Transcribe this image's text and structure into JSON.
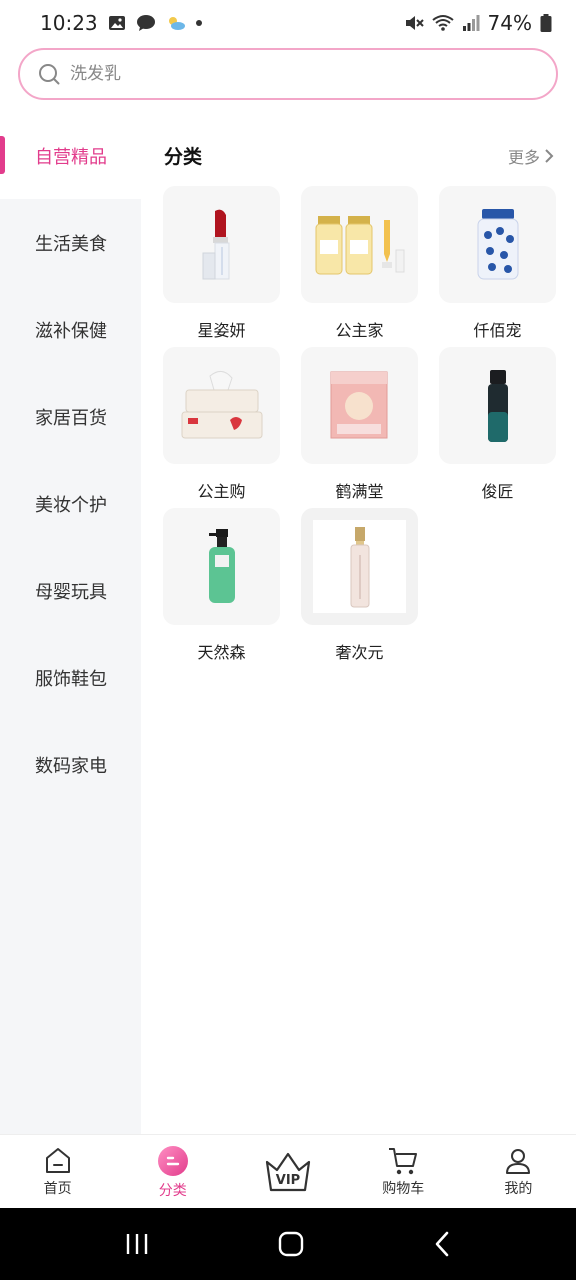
{
  "status_bar": {
    "time": "10:23",
    "battery": "74%"
  },
  "search": {
    "placeholder": "洗发乳"
  },
  "sidebar": {
    "items": [
      {
        "label": "自营精品",
        "active": true
      },
      {
        "label": "生活美食"
      },
      {
        "label": "滋补保健"
      },
      {
        "label": "家居百货"
      },
      {
        "label": "美妆个护"
      },
      {
        "label": "母婴玩具"
      },
      {
        "label": "服饰鞋包"
      },
      {
        "label": "数码家电"
      }
    ]
  },
  "main": {
    "section_title": "分类",
    "more_label": "更多",
    "brands": [
      {
        "name": "星姿妍",
        "icon": "lipstick"
      },
      {
        "name": "公主家",
        "icon": "serum-vials"
      },
      {
        "name": "仟佰宠",
        "icon": "supplement-bottle"
      },
      {
        "name": "公主购",
        "icon": "tissue-pack"
      },
      {
        "name": "鹤满堂",
        "icon": "mask-box"
      },
      {
        "name": "俊匠",
        "icon": "foam-bottle"
      },
      {
        "name": "天然森",
        "icon": "shampoo-bottle"
      },
      {
        "name": "奢次元",
        "icon": "perfume-bottle"
      }
    ]
  },
  "bottom_nav": {
    "items": [
      {
        "label": "首页",
        "icon": "home-icon"
      },
      {
        "label": "分类",
        "icon": "category-icon",
        "active": true
      },
      {
        "label": "",
        "icon": "vip-crown-icon",
        "badge_text": "VIP"
      },
      {
        "label": "购物车",
        "icon": "cart-icon"
      },
      {
        "label": "我的",
        "icon": "profile-icon"
      }
    ]
  },
  "colors": {
    "accent": "#e23c8c",
    "search_border": "#f3a6c8",
    "sidebar_bg": "#f5f6f8",
    "thumb_bg": "#f6f6f6"
  }
}
